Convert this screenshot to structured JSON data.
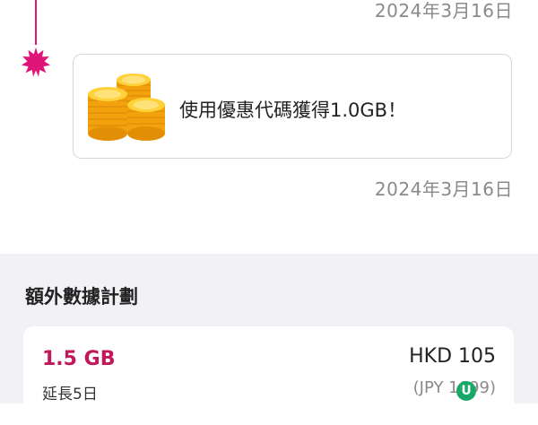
{
  "timeline": {
    "dot_color": "#e0157a",
    "date_top": "2024年3月16日",
    "date_mid": "2024年3月16日"
  },
  "promo_card": {
    "icon": "gold-coins-icon",
    "message": "使用優惠代碼獲得1.0GB！"
  },
  "extra_plans": {
    "title": "額外數據計劃",
    "plans": [
      {
        "size": "1.5 GB",
        "duration": "延長5日",
        "price": "HKD 105",
        "price_jpy": "(JPY 1099)"
      }
    ]
  },
  "colors": {
    "accent": "#c2185b",
    "section_bg": "#f2f2f6"
  }
}
